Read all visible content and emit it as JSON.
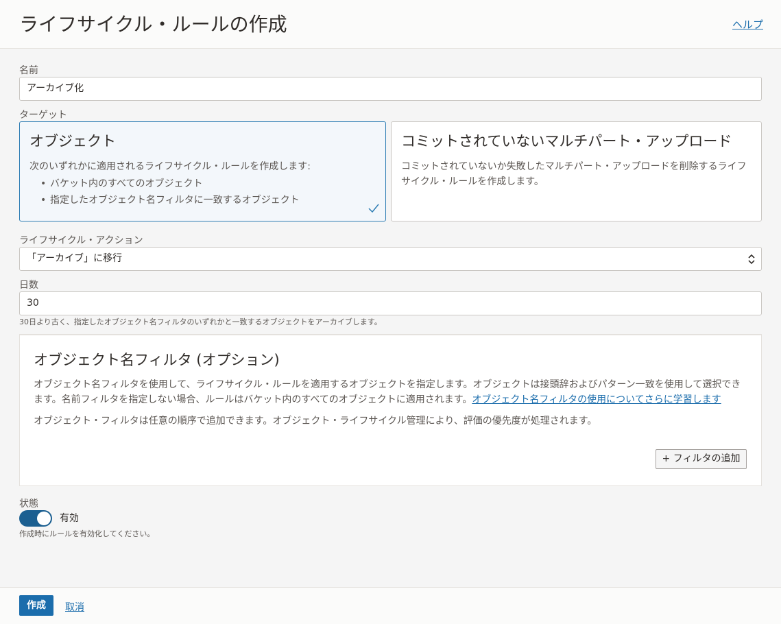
{
  "header": {
    "title": "ライフサイクル・ルールの作成",
    "help_link": "ヘルプ"
  },
  "form": {
    "name": {
      "label": "名前",
      "value": "アーカイブ化"
    },
    "target": {
      "label": "ターゲット",
      "options": [
        {
          "title": "オブジェクト",
          "description": "次のいずれかに適用されるライフサイクル・ルールを作成します:",
          "bullets": [
            "バケット内のすべてのオブジェクト",
            "指定したオブジェクト名フィルタに一致するオブジェクト"
          ],
          "selected": true
        },
        {
          "title": "コミットされていないマルチパート・アップロード",
          "description": "コミットされていないか失敗したマルチパート・アップロードを削除するライフサイクル・ルールを作成します。",
          "selected": false
        }
      ]
    },
    "action": {
      "label": "ライフサイクル・アクション",
      "value": "「アーカイブ」に移行"
    },
    "days": {
      "label": "日数",
      "value": "30",
      "hint": "30日より古く、指定したオブジェクト名フィルタのいずれかと一致するオブジェクトをアーカイブします。"
    },
    "filters": {
      "title": "オブジェクト名フィルタ (オプション)",
      "paragraph1": "オブジェクト名フィルタを使用して、ライフサイクル・ルールを適用するオブジェクトを指定します。オブジェクトは接頭辞およびパターン一致を使用して選択できます。名前フィルタを指定しない場合、ルールはバケット内のすべてのオブジェクトに適用されます。",
      "learn_more_link": "オブジェクト名フィルタの使用についてさらに学習します",
      "paragraph2": "オブジェクト・フィルタは任意の順序で追加できます。オブジェクト・ライフサイクル管理により、評価の優先度が処理されます。",
      "add_button": "+ フィルタの追加"
    },
    "state": {
      "label": "状態",
      "toggle_label": "有効",
      "enabled": true,
      "hint": "作成時にルールを有効化してください。"
    }
  },
  "footer": {
    "create_button": "作成",
    "cancel_link": "取消"
  },
  "colors": {
    "accent": "#1b6dac",
    "toggle_on": "#1b5f91",
    "selected_border": "#2c7cb3",
    "background": "#f5f5f5"
  }
}
